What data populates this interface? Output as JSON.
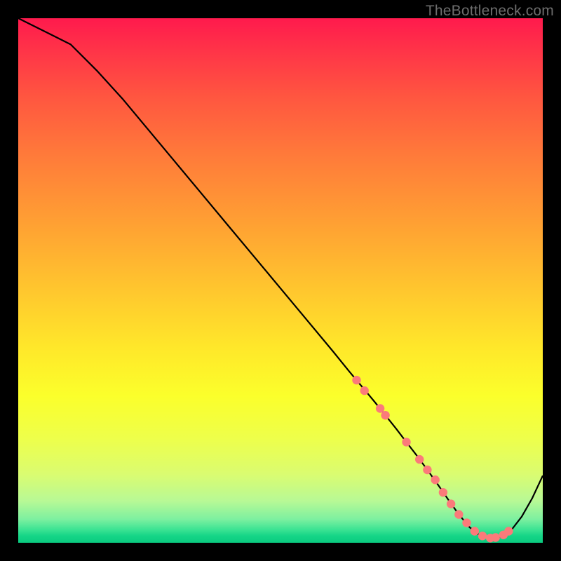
{
  "watermark": "TheBottleneck.com",
  "colors": {
    "curve": "#000000",
    "dot_fill": "#fb7a7a",
    "dot_stroke": "#cc5858",
    "gradient_top": "#ff1a4d",
    "gradient_bottom": "#0acb80"
  },
  "chart_data": {
    "type": "line",
    "title": "",
    "xlabel": "",
    "ylabel": "",
    "xlim": [
      0,
      100
    ],
    "ylim": [
      0,
      100
    ],
    "grid": false,
    "series": [
      {
        "name": "bottleneck-curve",
        "x": [
          0,
          2,
          6,
          10,
          15,
          20,
          25,
          30,
          35,
          40,
          45,
          50,
          55,
          60,
          63,
          66,
          68,
          70,
          72,
          74,
          76,
          78,
          80,
          82,
          84,
          86,
          88,
          90,
          92,
          94,
          96,
          98,
          100
        ],
        "values": [
          100,
          99,
          97,
          95,
          90,
          84.5,
          78.5,
          72.5,
          66.5,
          60.5,
          54.5,
          48.5,
          42.5,
          36.5,
          32.8,
          29.2,
          26.8,
          24.3,
          21.8,
          19.2,
          16.6,
          13.9,
          11.1,
          8.2,
          5.4,
          3.0,
          1.4,
          0.9,
          1.1,
          2.4,
          5.0,
          8.5,
          12.8
        ]
      }
    ],
    "scatter_points": {
      "name": "marked-points",
      "x": [
        64.5,
        66.0,
        69.0,
        70.0,
        74.0,
        76.5,
        78.0,
        79.5,
        81.0,
        82.5,
        84.0,
        85.5,
        87.0,
        88.5,
        90.0,
        91.0,
        92.5,
        93.5
      ],
      "values": [
        31.0,
        29.0,
        25.6,
        24.3,
        19.2,
        15.9,
        13.9,
        12.0,
        9.6,
        7.4,
        5.4,
        3.8,
        2.2,
        1.3,
        0.9,
        1.0,
        1.5,
        2.2
      ]
    }
  }
}
